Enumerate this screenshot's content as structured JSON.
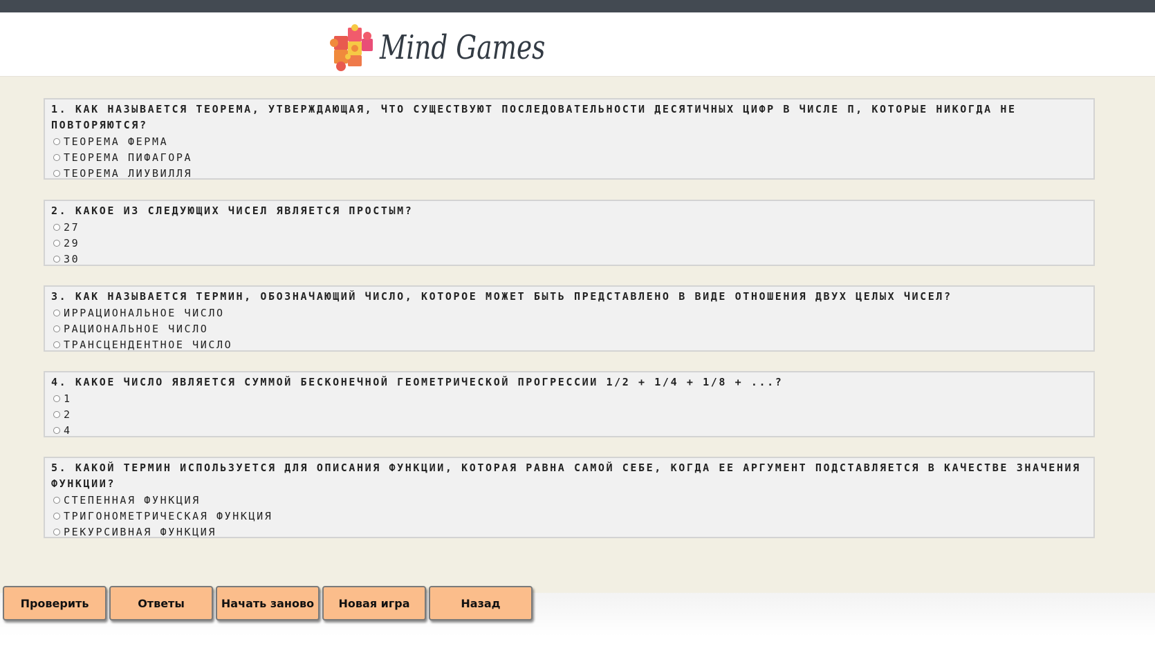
{
  "header": {
    "logo_text": "Mind Games",
    "colors": {
      "topbar": "#434a52",
      "logo_text": "#333b44"
    }
  },
  "questions": [
    {
      "title": "1. Как называется теорема, утверждающая, что существуют последовательности десятичных цифр в числе π, которые никогда не повторяются?",
      "options": [
        "Теорема Ферма",
        "Теорема Пифагора",
        "Теорема Лиувилля"
      ]
    },
    {
      "title": "2. Какое из следующих чисел является простым?",
      "options": [
        "27",
        "29",
        "30"
      ]
    },
    {
      "title": "3. Как называется термин, обозначающий число, которое может быть представлено в виде отношения двух целых чисел?",
      "options": [
        "Иррациональное число",
        "Рациональное число",
        "Трансцендентное число"
      ]
    },
    {
      "title": "4. Какое число является суммой бесконечной геометрической прогрессии 1/2 + 1/4 + 1/8 + ...?",
      "options": [
        "1",
        "2",
        "4"
      ]
    },
    {
      "title": "5. Какой термин используется для описания функции, которая равна самой себе, когда ее аргумент подставляется в качестве значения функции?",
      "options": [
        "Степенная функция",
        "Тригонометрическая функция",
        "Рекурсивная функция"
      ]
    }
  ],
  "buttons": {
    "check": "Проверить",
    "answers": "Ответы",
    "restart": "Начать заново",
    "new_game": "Новая игра",
    "back": "Назад"
  },
  "colors": {
    "page_background": "#f2efe3",
    "question_background": "#f1f1f1",
    "button_background": "#fbbd8b"
  }
}
